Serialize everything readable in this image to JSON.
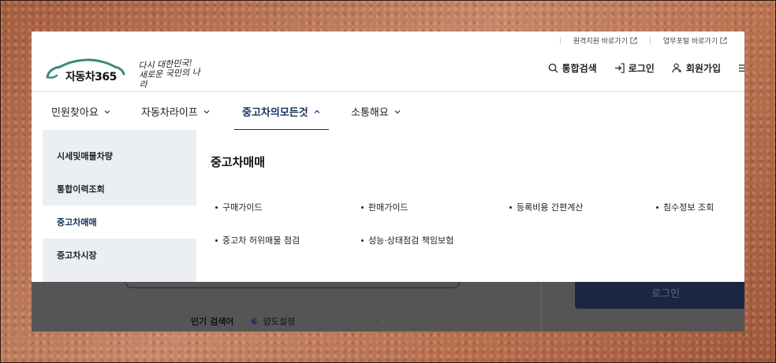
{
  "utility": {
    "links": [
      {
        "label": "원격지원 바로가기",
        "icon": "external-link-icon"
      },
      {
        "label": "업무포털 바로가기",
        "icon": "external-link-icon"
      }
    ]
  },
  "logo": {
    "text": "자동차365",
    "slogan": "다시 대한민국! 새로운 국민의 나라",
    "brand_color": "#3d8a7a"
  },
  "header": {
    "actions": [
      {
        "label": "통합검색",
        "icon": "search-icon"
      },
      {
        "label": "로그인",
        "icon": "login-icon"
      },
      {
        "label": "회원가입",
        "icon": "user-add-icon"
      }
    ]
  },
  "gnb": {
    "items": [
      {
        "label": "민원찾아요",
        "icon": "chevron-down-icon",
        "active": false
      },
      {
        "label": "자동차라이프",
        "icon": "chevron-down-icon",
        "active": false
      },
      {
        "label": "중고차의모든것",
        "icon": "chevron-up-icon",
        "active": true
      },
      {
        "label": "소통해요",
        "icon": "chevron-down-icon",
        "active": false
      }
    ],
    "accent_color": "#14305e"
  },
  "mega": {
    "side_items": [
      {
        "label": "시세및매물차량",
        "active": false
      },
      {
        "label": "통합이력조회",
        "active": false
      },
      {
        "label": "중고차매매",
        "active": true
      },
      {
        "label": "중고차시장",
        "active": false
      }
    ],
    "title": "중고차매매",
    "links": [
      "구매가이드",
      "판매가이드",
      "등록비용 간편계산",
      "침수정보 조회",
      "중고차 허위매물 점검",
      "성능·상태점검 책임보험"
    ]
  },
  "background_page": {
    "login_button": "로그인",
    "popular_label": "인기 검색어",
    "popular_rank": "6",
    "popular_term": "양도설정",
    "dash": "-"
  }
}
